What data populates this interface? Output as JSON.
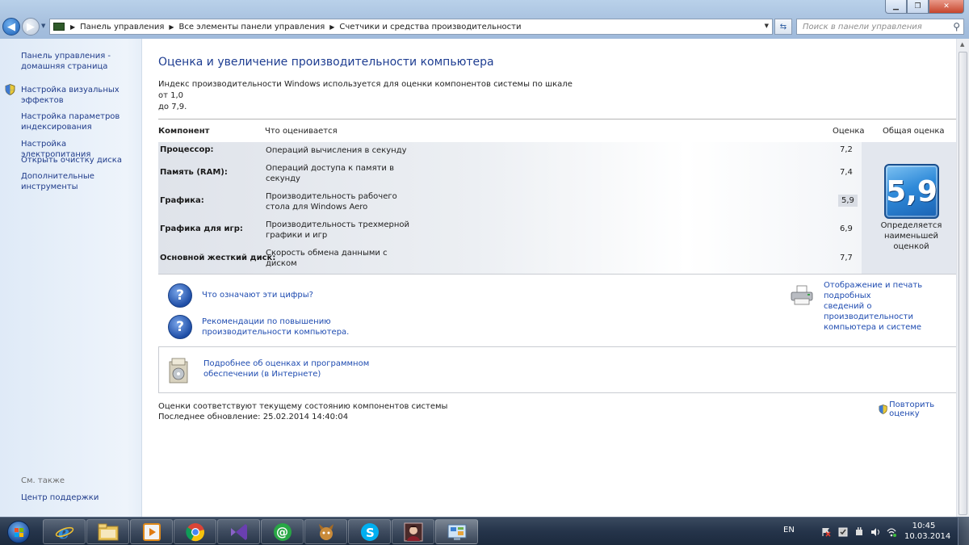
{
  "window": {
    "controls": {
      "minimize": "▁",
      "maximize": "❐",
      "close": "✕"
    }
  },
  "navigation": {
    "back_icon": "arrow-left-icon",
    "forward_icon": "arrow-right-icon"
  },
  "address_bar": {
    "crumbs": [
      "Панель управления",
      "Все элементы панели управления",
      "Счетчики и средства производительности"
    ]
  },
  "search": {
    "placeholder": "Поиск в панели управления"
  },
  "sidebar": {
    "home_line1": "Панель управления -",
    "home_line2": "домашняя страница",
    "items": [
      {
        "label": "Настройка визуальных эффектов",
        "line1": "Настройка визуальных",
        "line2": "эффектов",
        "shield": true
      },
      {
        "label": "Настройка параметров индексирования",
        "line1": "Настройка параметров",
        "line2": "индексирования",
        "shield": false
      },
      {
        "label": "Настройка электропитания",
        "line1": "Настройка электропитания",
        "line2": "",
        "shield": false
      },
      {
        "label": "Открыть очистку диска",
        "line1": "Открыть очистку диска",
        "line2": "",
        "shield": false
      },
      {
        "label": "Дополнительные инструменты",
        "line1": "Дополнительные",
        "line2": "инструменты",
        "shield": false
      }
    ],
    "see_also": "См. также",
    "support_center": "Центр поддержки"
  },
  "main": {
    "title": "Оценка и увеличение производительности компьютера",
    "intro_line1": "Индекс производительности Windows используется для оценки компонентов системы по шкале от 1,0",
    "intro_line2": "до 7,9.",
    "table": {
      "headers": {
        "component": "Компонент",
        "what": "Что оценивается",
        "score": "Оценка",
        "base": "Общая оценка"
      },
      "rows": [
        {
          "component": "Процессор:",
          "what_line1": "Операций вычисления в секунду",
          "what_line2": "",
          "score": "7,2"
        },
        {
          "component": "Память (RAM):",
          "what_line1": "Операций доступа к памяти в",
          "what_line2": "секунду",
          "score": "7,4"
        },
        {
          "component": "Графика:",
          "what_line1": "Производительность рабочего",
          "what_line2": "стола для Windows Aero",
          "score": "5,9"
        },
        {
          "component": "Графика для игр:",
          "what_line1": "Производительность трехмерной",
          "what_line2": "графики и игр",
          "score": "6,9"
        },
        {
          "component": "Основной жесткий диск:",
          "what_line1": "Скорость обмена данными с",
          "what_line2": "диском",
          "score": "7,7"
        }
      ],
      "base_score": "5,9",
      "base_label_line1": "Определяется",
      "base_label_line2": "наименьшей",
      "base_label_line3": "оценкой"
    },
    "links": {
      "what_numbers": "Что означают эти цифры?",
      "tips_line1": "Рекомендации по повышению",
      "tips_line2": "производительности компьютера.",
      "print_line1": "Отображение и печать подробных",
      "print_line2": "сведений о производительности",
      "print_line3": "компьютера и системе",
      "online_line1": "Подробнее об оценках и программном",
      "online_line2": "обеспечении (в Интернете)"
    },
    "status_line1": "Оценки соответствуют текущему состоянию компонентов системы",
    "status_line2": "Последнее обновление: 25.02.2014 14:40:04",
    "rerun": "Повторить оценку"
  },
  "taskbar": {
    "apps": [
      "internet-explorer",
      "windows-explorer",
      "media-player",
      "chrome",
      "visual-studio",
      "mail-agent",
      "game-app",
      "skype",
      "anime-app",
      "control-panel"
    ],
    "language": "EN",
    "time": "10:45",
    "date": "10.03.2014"
  },
  "colors": {
    "link": "#1e4bb0",
    "title": "#1e3d91",
    "badge": "#2f8ad9"
  }
}
